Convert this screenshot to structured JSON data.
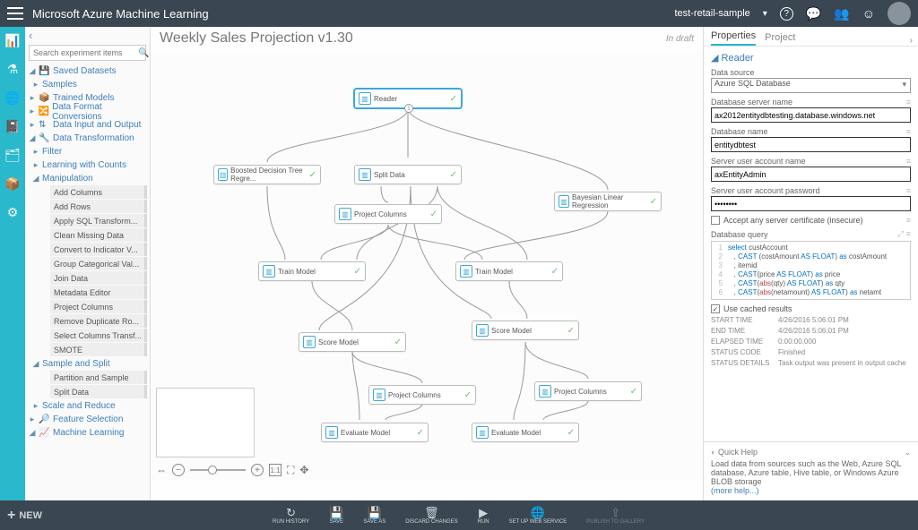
{
  "app": {
    "brand": "Microsoft Azure Machine Learning",
    "workspace": "test-retail-sample"
  },
  "sidebar": {
    "search_placeholder": "Search experiment items",
    "collapse_glyph": "‹",
    "groups": {
      "saved": "Saved Datasets",
      "samples": "Samples",
      "trained": "Trained Models",
      "dfc": "Data Format Conversions",
      "dio": "Data Input and Output",
      "dt": "Data Transformation",
      "filter": "Filter",
      "lwc": "Learning with Counts",
      "manip": "Manipulation",
      "ss": "Sample and Split",
      "sr": "Scale and Reduce",
      "fs": "Feature Selection",
      "ml": "Machine Learning"
    },
    "manip_items": [
      "Add Columns",
      "Add Rows",
      "Apply SQL Transform...",
      "Clean Missing Data",
      "Convert to Indicator V...",
      "Group Categorical Val...",
      "Join Data",
      "Metadata Editor",
      "Project Columns",
      "Remove Duplicate Ro...",
      "Select Columns Transf...",
      "SMOTE"
    ],
    "ss_items": [
      "Partition and Sample",
      "Split Data"
    ]
  },
  "main": {
    "title": "Weekly Sales Projection v1.30",
    "status": "In draft"
  },
  "modules": {
    "reader": "Reader",
    "bdt": "Boosted Decision Tree Regre...",
    "split": "Split Data",
    "projcol": "Project Columns",
    "blr": "Bayesian Linear Regression",
    "train": "Train Model",
    "score": "Score Model",
    "eval": "Evaluate Model"
  },
  "zoom": {
    "ratio": "1:1"
  },
  "props": {
    "tab_properties": "Properties",
    "tab_project": "Project",
    "section": "Reader",
    "data_source_label": "Data source",
    "data_source_value": "Azure SQL Database",
    "server_label": "Database server name",
    "server_value": "ax2012entitydbtesting.database.windows.net",
    "db_label": "Database name",
    "db_value": "entitydbtest",
    "user_label": "Server user account name",
    "user_value": "axEntityAdmin",
    "pass_label": "Server user account password",
    "pass_value": "••••••••",
    "cert_label": "Accept any server certificate (insecure)",
    "query_label": "Database query",
    "query_lines": [
      "select custAccount",
      "    , CAST (costAmount AS FLOAT) as costAmount",
      "    , itemid",
      "    , CAST(price AS FLOAT) as price",
      "    , CAST(abs(qty) AS FLOAT) as qty",
      "    , CAST(abs(netamount) AS FLOAT) as netamt"
    ],
    "cache_label": "Use cached results",
    "meta": {
      "start_k": "START TIME",
      "start_v": "4/26/2016 5:06:01 PM",
      "end_k": "END TIME",
      "end_v": "4/26/2016 5:06:01 PM",
      "elapsed_k": "ELAPSED TIME",
      "elapsed_v": "0:00:00.000",
      "status_k": "STATUS CODE",
      "status_v": "Finished",
      "details_k": "STATUS DETAILS",
      "details_v": "Task output was present in output cache"
    }
  },
  "quickhelp": {
    "title": "Quick Help",
    "body": "Load data from sources such as the Web, Azure SQL database, Azure table, Hive table, or Windows Azure BLOB storage",
    "more": "(more help...)"
  },
  "bottom": {
    "new": "NEW",
    "items": [
      "RUN HISTORY",
      "SAVE",
      "SAVE AS",
      "DISCARD CHANGES",
      "RUN",
      "SET UP WEB SERVICE",
      "PUBLISH TO GALLERY"
    ]
  }
}
